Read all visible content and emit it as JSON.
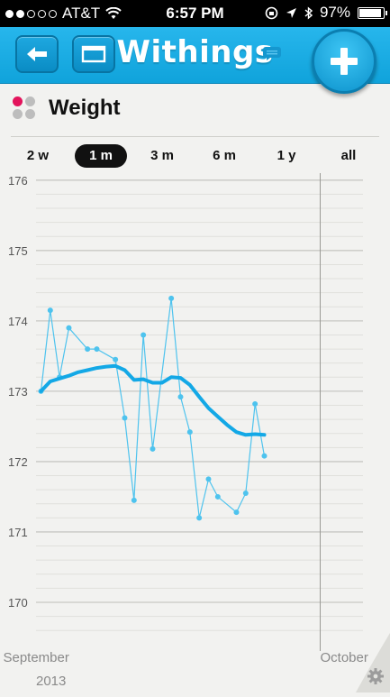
{
  "status_bar": {
    "carrier": "AT&T",
    "time": "6:57 PM",
    "battery": "97%"
  },
  "nav": {
    "title": "Withings",
    "back_icon": "arrow-left-icon",
    "window_icon": "window-icon",
    "add_icon": "plus-icon"
  },
  "metric": {
    "title": "Weight"
  },
  "range_tabs": [
    {
      "label": "2 w",
      "selected": false
    },
    {
      "label": "1 m",
      "selected": true
    },
    {
      "label": "3 m",
      "selected": false
    },
    {
      "label": "6 m",
      "selected": false
    },
    {
      "label": "1 y",
      "selected": false
    },
    {
      "label": "all",
      "selected": false
    }
  ],
  "chart_data": {
    "type": "line",
    "y_ticks": [
      "176",
      "175",
      "174",
      "173",
      "172",
      "171",
      "170"
    ],
    "ylim": [
      169.5,
      176.1
    ],
    "x_labels": [
      {
        "label": "September",
        "day": 0
      },
      {
        "label": "October",
        "day": 30
      }
    ],
    "x_sublabel": "2013",
    "x_range_days": [
      -4.4,
      37.5
    ],
    "month_divider_day": 30,
    "series": [
      {
        "style": "thin",
        "color": "#4ec3ee",
        "points": [
          [
            0,
            173.0
          ],
          [
            1,
            174.15
          ],
          [
            2,
            173.2
          ],
          [
            3,
            173.9
          ],
          [
            5,
            173.6
          ],
          [
            6,
            173.6
          ],
          [
            8,
            173.45
          ],
          [
            9,
            172.62
          ],
          [
            10,
            171.45
          ],
          [
            11,
            173.8
          ],
          [
            12,
            172.18
          ],
          [
            14,
            174.32
          ],
          [
            15,
            172.92
          ],
          [
            16,
            172.42
          ],
          [
            17,
            171.2
          ],
          [
            18,
            171.75
          ],
          [
            19,
            171.5
          ],
          [
            21,
            171.28
          ],
          [
            22,
            171.55
          ],
          [
            23,
            172.82
          ],
          [
            24,
            172.08
          ]
        ]
      },
      {
        "style": "thick",
        "color": "#13a8e6",
        "points": [
          [
            0,
            173.0
          ],
          [
            1,
            173.14
          ],
          [
            2,
            173.18
          ],
          [
            3,
            173.22
          ],
          [
            4,
            173.27
          ],
          [
            5,
            173.3
          ],
          [
            6,
            173.33
          ],
          [
            7,
            173.35
          ],
          [
            8,
            173.36
          ],
          [
            9,
            173.3
          ],
          [
            10,
            173.16
          ],
          [
            11,
            173.17
          ],
          [
            12,
            173.12
          ],
          [
            13,
            173.12
          ],
          [
            14,
            173.2
          ],
          [
            15,
            173.19
          ],
          [
            16,
            173.09
          ],
          [
            17,
            172.92
          ],
          [
            18,
            172.76
          ],
          [
            19,
            172.64
          ],
          [
            20,
            172.52
          ],
          [
            21,
            172.42
          ],
          [
            22,
            172.38
          ],
          [
            23,
            172.39
          ],
          [
            24,
            172.38
          ]
        ]
      }
    ]
  }
}
